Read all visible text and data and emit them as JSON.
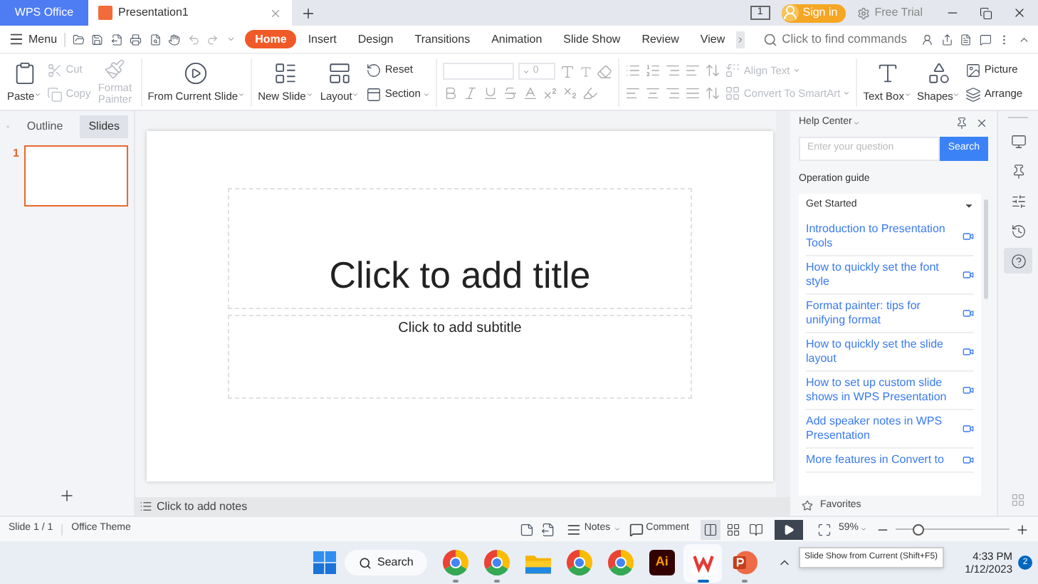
{
  "title_bar": {
    "home_tab": "WPS Office",
    "document_tab": "Presentation1",
    "page_badge": "1",
    "sign_in": "Sign in",
    "free_trial": "Free Trial"
  },
  "menu": "Menu",
  "ribbon_tabs": [
    {
      "label": "Home",
      "selected": true
    },
    {
      "label": "Insert",
      "selected": false
    },
    {
      "label": "Design",
      "selected": false
    },
    {
      "label": "Transitions",
      "selected": false
    },
    {
      "label": "Animation",
      "selected": false
    },
    {
      "label": "Slide Show",
      "selected": false
    },
    {
      "label": "Review",
      "selected": false
    },
    {
      "label": "View",
      "selected": false
    }
  ],
  "command_search": {
    "placeholder": "Click to find commands"
  },
  "ribbon": {
    "paste": "Paste",
    "cut": {
      "label": "Cut",
      "disabled": true
    },
    "copy": {
      "label": "Copy",
      "disabled": true
    },
    "format_painter": {
      "label": "Format Painter",
      "disabled": true
    },
    "from_current_slide": "From Current Slide",
    "new_slide": "New Slide",
    "layout": "Layout",
    "reset": "Reset",
    "section": "Section",
    "font_size": "0",
    "align_text": {
      "label": "Align Text",
      "disabled": true
    },
    "convert_smartart": {
      "label": "Convert To SmartArt",
      "disabled": true
    },
    "text_box": "Text Box",
    "shapes": "Shapes",
    "picture": "Picture",
    "arrange": "Arrange"
  },
  "panel_tabs": [
    {
      "label": "Outline",
      "selected": false
    },
    {
      "label": "Slides",
      "selected": true
    }
  ],
  "slides": [
    {
      "number": "1",
      "selected": true
    }
  ],
  "slide": {
    "title": "Click to add title",
    "subtitle": "Click to add subtitle"
  },
  "notes_hint": "Click to add notes",
  "help_center": {
    "title": "Help Center",
    "search_placeholder": "Enter your question",
    "search_button": "Search",
    "section": "Operation guide",
    "category": "Get Started",
    "articles": [
      "Introduction to Presentation Tools",
      "How to quickly set the font style",
      "Format painter: tips for unifying format",
      "How to quickly set the slide layout",
      "How to set up custom slide shows in WPS Presentation",
      "Add speaker notes in WPS Presentation",
      "More features in Convert to"
    ],
    "favorites": "Favorites"
  },
  "side_tools": [
    {
      "kind": "slides",
      "selected": false
    },
    {
      "kind": "pin",
      "selected": false
    },
    {
      "kind": "settings",
      "selected": false
    },
    {
      "kind": "history",
      "selected": false
    },
    {
      "kind": "help",
      "selected": true
    }
  ],
  "status_bar": {
    "slide": "Slide 1 / 1",
    "theme": "Office Theme",
    "notes": "Notes",
    "comment": "Comment",
    "views": [
      {
        "kind": "normal",
        "selected": true
      },
      {
        "kind": "sorter",
        "selected": false
      },
      {
        "kind": "reading",
        "selected": false
      }
    ],
    "zoom": "59%",
    "zoom_slider": {
      "level": 0.2
    }
  },
  "tooltip": "Slide Show from Current (Shift+F5)",
  "taskbar": {
    "search": "Search",
    "apps": [
      {
        "kind": "chrome",
        "running": true,
        "selected": false
      },
      {
        "kind": "chrome",
        "running": true,
        "selected": false
      },
      {
        "kind": "folder",
        "running": false,
        "selected": false
      },
      {
        "kind": "chrome",
        "running": false,
        "selected": false
      },
      {
        "kind": "chrome",
        "running": false,
        "selected": false
      },
      {
        "kind": "illustrator",
        "label": "Ai",
        "running": false,
        "selected": false
      },
      {
        "kind": "wps",
        "running": true,
        "selected": true
      },
      {
        "kind": "powerpoint",
        "running": true,
        "selected": false
      }
    ],
    "time": "4:33 PM",
    "date": "1/12/2023",
    "notification_count": "2"
  }
}
